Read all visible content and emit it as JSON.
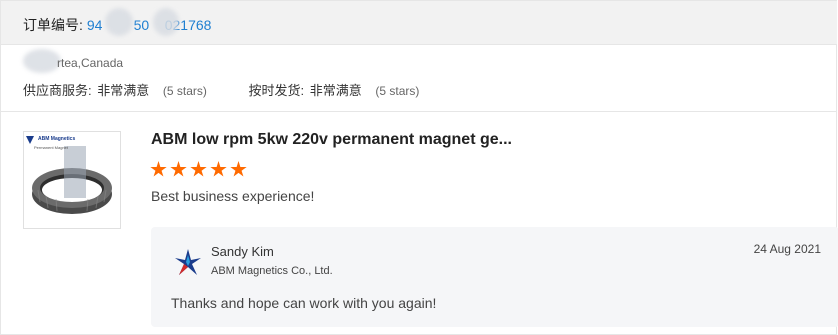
{
  "order": {
    "label": "订单编号:",
    "number": "94        50    021768"
  },
  "buyer": {
    "location": "rtea,Canada"
  },
  "ratings": [
    {
      "label": "供应商服务:",
      "value": "非常满意",
      "stars": "(5 stars)"
    },
    {
      "label": "按时发货:",
      "value": "非常满意",
      "stars": "(5 stars)"
    }
  ],
  "product": {
    "thumbnail_brand": "ABM Magnetics",
    "thumbnail_sub": "Permanent Magnet",
    "title": "ABM low rpm 5kw 220v permanent magnet ge...",
    "rating": 5,
    "star_color": "#ff6a00",
    "review": "Best business experience!"
  },
  "reply": {
    "name": "Sandy Kim",
    "company": "ABM Magnetics Co., Ltd.",
    "date": "24 Aug 2021",
    "text": "Thanks and hope can work with you again!"
  },
  "colors": {
    "link": "#1f7fd1",
    "header_bg": "#f2f2f2",
    "reply_bg": "#f5f6f8"
  }
}
